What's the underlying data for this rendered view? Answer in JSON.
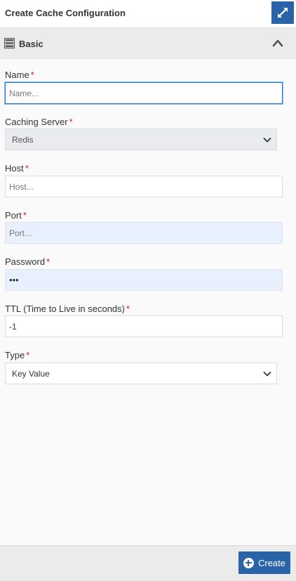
{
  "header": {
    "title": "Create Cache Configuration"
  },
  "section": {
    "title": "Basic"
  },
  "fields": {
    "name": {
      "label": "Name",
      "required": "*",
      "placeholder": "Name...",
      "value": ""
    },
    "caching_server": {
      "label": "Caching Server",
      "required": "*",
      "value": "Redis"
    },
    "host": {
      "label": "Host",
      "required": "*",
      "placeholder": "Host...",
      "value": ""
    },
    "port": {
      "label": "Port",
      "required": "*",
      "placeholder": "Port...",
      "value": ""
    },
    "password": {
      "label": "Password",
      "required": "*",
      "value": "•••"
    },
    "ttl": {
      "label": "TTL (Time to Live in seconds)",
      "required": "*",
      "value": "-1"
    },
    "type": {
      "label": "Type",
      "required": "*",
      "value": "Key Value"
    }
  },
  "footer": {
    "create_label": "Create"
  },
  "colors": {
    "primary": "#2a64a8",
    "required": "#d5212b",
    "focus": "#2b78c4",
    "autofill": "#e8f0fe"
  }
}
